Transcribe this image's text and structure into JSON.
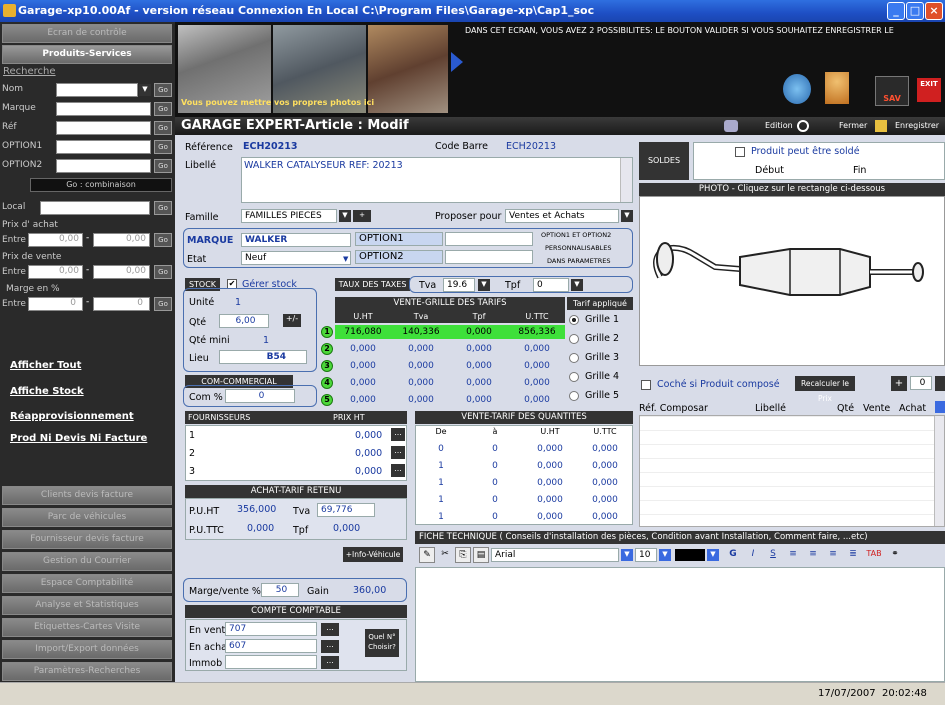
{
  "window": {
    "title": "Garage-xp10.00Af - version réseau Connexion En Local  C:\\Program Files\\Garage-xp\\Cap1_soc"
  },
  "left": {
    "ecran_controle": "Ecran de contrôle",
    "produits_services": "Produits-Services",
    "recherche": "Recherche",
    "search_labels": [
      "Nom",
      "Marque",
      "Réf",
      "OPTION1",
      "OPTION2"
    ],
    "go": "Go",
    "combinaison": "Go : combinaison",
    "local": "Local",
    "prix_achat": "Prix d' achat",
    "prix_vente": "Prix de vente",
    "marge": "Marge en %",
    "entre": "Entre",
    "zero_dec": "0,00",
    "zero": "0",
    "links": [
      "Afficher Tout",
      "Affiche Stock",
      "Réapprovisionnement",
      "Prod Ni Devis Ni Facture"
    ],
    "nav": [
      "Clients devis facture",
      "Parc de véhicules",
      "Fournisseur devis facture",
      "Gestion du Courrier",
      "Espace Comptabilité",
      "Analyse et Statistiques",
      "Etiquettes-Cartes Visite",
      "Import/Export données",
      "Paramètres-Recherches"
    ]
  },
  "banner": {
    "message": "DANS CET ECRAN, VOUS AVEZ 2 POSSIBILITES: LE BOUTON VALIDER SI VOUS SOUHAITEZ ENREGISTRER LE",
    "photo_caption": "Vous pouvez mettre vos propres photos ici",
    "sav": "SAV",
    "exit": "EXIT"
  },
  "header": {
    "title": "GARAGE EXPERT-Article : Modif",
    "edition": "Edition",
    "fermer": "Fermer",
    "enregistrer": "Enregistrer"
  },
  "article": {
    "reference_label": "Référence",
    "reference": "ECH20213",
    "codebarre_label": "Code Barre",
    "codebarre": "ECH20213",
    "libelle_label": "Libellé",
    "libelle": "WALKER  CATALYSEUR REF: 20213",
    "famille_label": "Famille",
    "famille": "FAMILLES PIECES",
    "proposer_label": "Proposer pour",
    "proposer": "Ventes et Achats",
    "marque_label": "MARQUE",
    "marque": "WALKER",
    "etat_label": "Etat",
    "etat": "Neuf",
    "option1": "OPTION1",
    "option2": "OPTION2",
    "options_note": [
      "OPTION1 ET OPTION2",
      "PERSONNALISABLES",
      "DANS PARAMETRES"
    ]
  },
  "soldes": {
    "label": "SOLDES",
    "peut_solde": "Produit peut être soldé",
    "debut": "Début",
    "fin": "Fin"
  },
  "photo": {
    "header": "PHOTO - Cliquez sur le rectangle ci-dessous"
  },
  "stock": {
    "label": "STOCK",
    "gerer": "Gérer stock",
    "unite_label": "Unité",
    "unite": "1",
    "qte_label": "Qté",
    "qte": "6,00",
    "plusminus": "+/-",
    "qtemini_label": "Qté mini",
    "qtemini": "1",
    "lieu_label": "Lieu",
    "lieu": "B54"
  },
  "commercial": {
    "label": "COM-COMMERCIAL",
    "com_label": "Com %",
    "com": "0"
  },
  "taxes": {
    "label": "TAUX DES TAXES",
    "tva_label": "Tva",
    "tva": "19.6",
    "tpf_label": "Tpf",
    "tpf": "0"
  },
  "grille": {
    "header": "VENTE-GRILLE DES TARIFS",
    "cols": [
      "U.HT",
      "Tva",
      "Tpf",
      "U.TTC"
    ],
    "rows": [
      [
        "716,080",
        "140,336",
        "0,000",
        "856,336"
      ],
      [
        "0,000",
        "0,000",
        "0,000",
        "0,000"
      ],
      [
        "0,000",
        "0,000",
        "0,000",
        "0,000"
      ],
      [
        "0,000",
        "0,000",
        "0,000",
        "0,000"
      ],
      [
        "0,000",
        "0,000",
        "0,000",
        "0,000"
      ]
    ],
    "nums": [
      "1",
      "2",
      "3",
      "4",
      "5"
    ],
    "tarif_label": "Tarif appliqué",
    "options": [
      "Grille 1",
      "Grille 2",
      "Grille 3",
      "Grille 4",
      "Grille 5"
    ]
  },
  "composes": {
    "coche": "Coché si Produit composé",
    "recalculer": "Recalculer le Prix",
    "plus": "+",
    "qty": "0",
    "cols": [
      "Réf. Composar",
      "Libellé",
      "Qté",
      "Vente",
      "Achat"
    ]
  },
  "fournisseurs": {
    "label": "FOURNISSEURS",
    "prix_label": "PRIX HT",
    "rows": [
      {
        "n": "1",
        "v": "0,000"
      },
      {
        "n": "2",
        "v": "0,000"
      },
      {
        "n": "3",
        "v": "0,000"
      }
    ],
    "dots": "..."
  },
  "quantites": {
    "header": "VENTE-TARIF DES QUANTITES",
    "cols": [
      "De",
      "à",
      "U.HT",
      "U.TTC"
    ],
    "rows": [
      [
        "0",
        "0",
        "0,000",
        "0,000"
      ],
      [
        "1",
        "0",
        "0,000",
        "0,000"
      ],
      [
        "1",
        "0",
        "0,000",
        "0,000"
      ],
      [
        "1",
        "0",
        "0,000",
        "0,000"
      ],
      [
        "1",
        "0",
        "0,000",
        "0,000"
      ]
    ]
  },
  "achat": {
    "header": "ACHAT-TARIF RETENU",
    "puht_label": "P.U.HT",
    "puht": "356,000",
    "tva_label": "Tva",
    "tva": "69,776",
    "puttc_label": "P.U.TTC",
    "puttc": "0,000",
    "tpf_label": "Tpf",
    "tpf": "0,000"
  },
  "fiche": {
    "header": "FICHE TECHNIQUE ( Conseils d'installation des pièces, Condition avant Installation, Comment faire, ...etc)",
    "font": "Arial",
    "size": "10",
    "tab": "TAB"
  },
  "info_vehicule": "+Info-Véhicule",
  "marge": {
    "label": "Marge/vente %",
    "value": "50",
    "gain_label": "Gain",
    "gain": "360,00"
  },
  "compte": {
    "header": "COMPTE COMPTABLE",
    "vente_label": "En vente",
    "vente": "707",
    "achat_label": "En achat",
    "achat": "607",
    "immob_label": "Immob",
    "immob": "",
    "quel": "Quel N° Choisir?"
  },
  "status": {
    "date": "17/07/2007",
    "time": "20:02:48"
  }
}
